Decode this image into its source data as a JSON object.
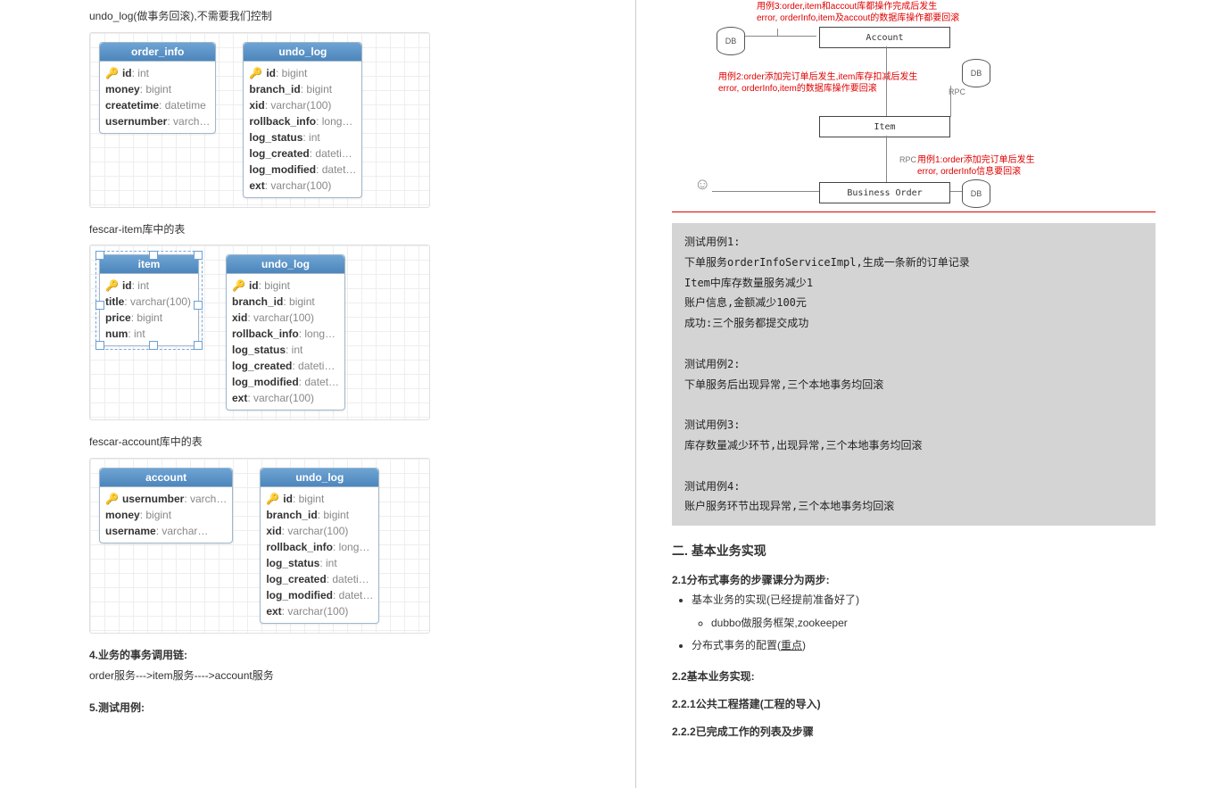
{
  "left": {
    "undoLine": "undo_log(做事务回滚),不需要我们控制",
    "order_info_table": {
      "name": "order_info",
      "fields": [
        {
          "key": true,
          "name": "id",
          "type": ": int"
        },
        {
          "key": false,
          "name": "money",
          "type": ": bigint"
        },
        {
          "key": false,
          "name": "createtime",
          "type": ": datetime"
        },
        {
          "key": false,
          "name": "usernumber",
          "type": ": varch…"
        }
      ]
    },
    "undo_log_table": {
      "name": "undo_log",
      "fields": [
        {
          "key": true,
          "name": "id",
          "type": ": bigint"
        },
        {
          "key": false,
          "name": "branch_id",
          "type": ": bigint"
        },
        {
          "key": false,
          "name": "xid",
          "type": ": varchar(100)"
        },
        {
          "key": false,
          "name": "rollback_info",
          "type": ": long…"
        },
        {
          "key": false,
          "name": "log_status",
          "type": ": int"
        },
        {
          "key": false,
          "name": "log_created",
          "type": ": dateti…"
        },
        {
          "key": false,
          "name": "log_modified",
          "type": ": datet…"
        },
        {
          "key": false,
          "name": "ext",
          "type": ": varchar(100)"
        }
      ]
    },
    "fescar_item_title": "fescar-item库中的表",
    "item_table": {
      "name": "item",
      "fields": [
        {
          "key": true,
          "name": "id",
          "type": ": int"
        },
        {
          "key": false,
          "name": "title",
          "type": ": varchar(100)"
        },
        {
          "key": false,
          "name": "price",
          "type": ": bigint"
        },
        {
          "key": false,
          "name": "num",
          "type": ": int"
        }
      ]
    },
    "fescar_account_title": "fescar-account库中的表",
    "account_table": {
      "name": "account",
      "fields": [
        {
          "key": true,
          "name": "usernumber",
          "type": ": varch…"
        },
        {
          "key": false,
          "name": "money",
          "type": ": bigint"
        },
        {
          "key": false,
          "name": "username",
          "type": ": varchar…"
        }
      ]
    },
    "chain_title": "4.业务的事务调用链:",
    "chain_body": "order服务--->item服务---->account服务",
    "test_title": "5.测试用例:"
  },
  "arch": {
    "note3": "用例3:order,item和accout库都操作完成后发生\nerror, orderInfo,item及accout的数据库操作都要回滚",
    "note2": "用例2:order添加完订单后发生,item库存扣减后发生\nerror, orderInfo,item的数据库操作要回滚",
    "note1": "用例1:order添加完订单后发生\nerror, orderInfo信息要回滚",
    "account": "Account",
    "item": "Item",
    "biz": "Business   Order",
    "db": "DB",
    "rpc": "RPC"
  },
  "testcases_text": "测试用例1:\n下单服务orderInfoServiceImpl,生成一条新的订单记录\nItem中库存数量服务减少1\n账户信息,金额减少100元\n成功:三个服务都提交成功\n\n测试用例2:\n下单服务后出现异常,三个本地事务均回滚\n\n测试用例3:\n库存数量减少环节,出现异常,三个本地事务均回滚\n\n测试用例4:\n账户服务环节出现异常,三个本地事务均回滚",
  "right": {
    "h_biz": "二. 基本业务实现",
    "h_21": "2.1分布式事务的步骤课分为两步:",
    "li1": "基本业务的实现(已经提前准备好了)",
    "li1a": "dubbo做服务框架,zookeeper",
    "li2_pre": "分布式事务的配置(",
    "li2_key": "重点",
    "li2_suf": ")",
    "h_22": "2.2基本业务实现:",
    "h_221": "2.2.1公共工程搭建(工程的导入)",
    "h_222": "2.2.2已完成工作的列表及步骤"
  }
}
